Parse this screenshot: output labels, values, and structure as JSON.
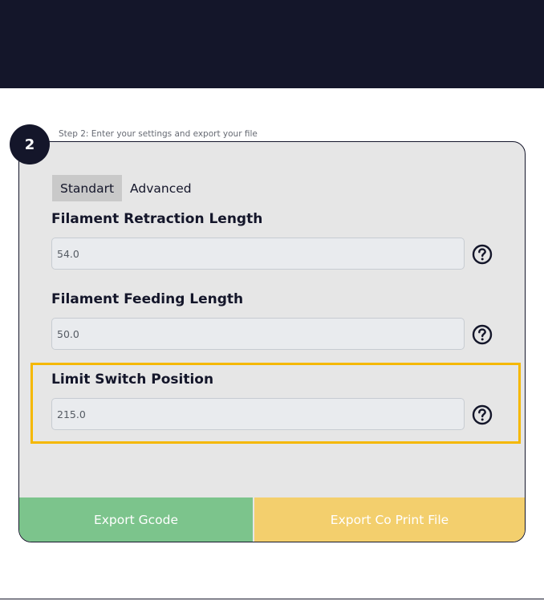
{
  "step": {
    "number": "2",
    "caption": "Step 2: Enter your settings and export your file"
  },
  "tabs": [
    {
      "label": "Standart",
      "active": true
    },
    {
      "label": "Advanced",
      "active": false
    }
  ],
  "fields": {
    "retraction": {
      "label": "Filament Retraction Length",
      "value": "54.0",
      "help_icon": "question-circle-icon"
    },
    "feeding": {
      "label": "Filament Feeding Length",
      "value": "50.0",
      "help_icon": "question-circle-icon"
    },
    "limit_switch": {
      "label": "Limit Switch Position",
      "value": "215.0",
      "help_icon": "question-circle-icon",
      "highlighted": true
    }
  },
  "buttons": {
    "export_gcode": "Export Gcode",
    "export_coprint": "Export Co Print File"
  },
  "colors": {
    "dark_navy": "#14162a",
    "panel_bg": "#e6e6e6",
    "gcode_green": "#7cc48c",
    "coprint_yellow": "#f3cf6d",
    "highlight_border": "#f5b800"
  }
}
